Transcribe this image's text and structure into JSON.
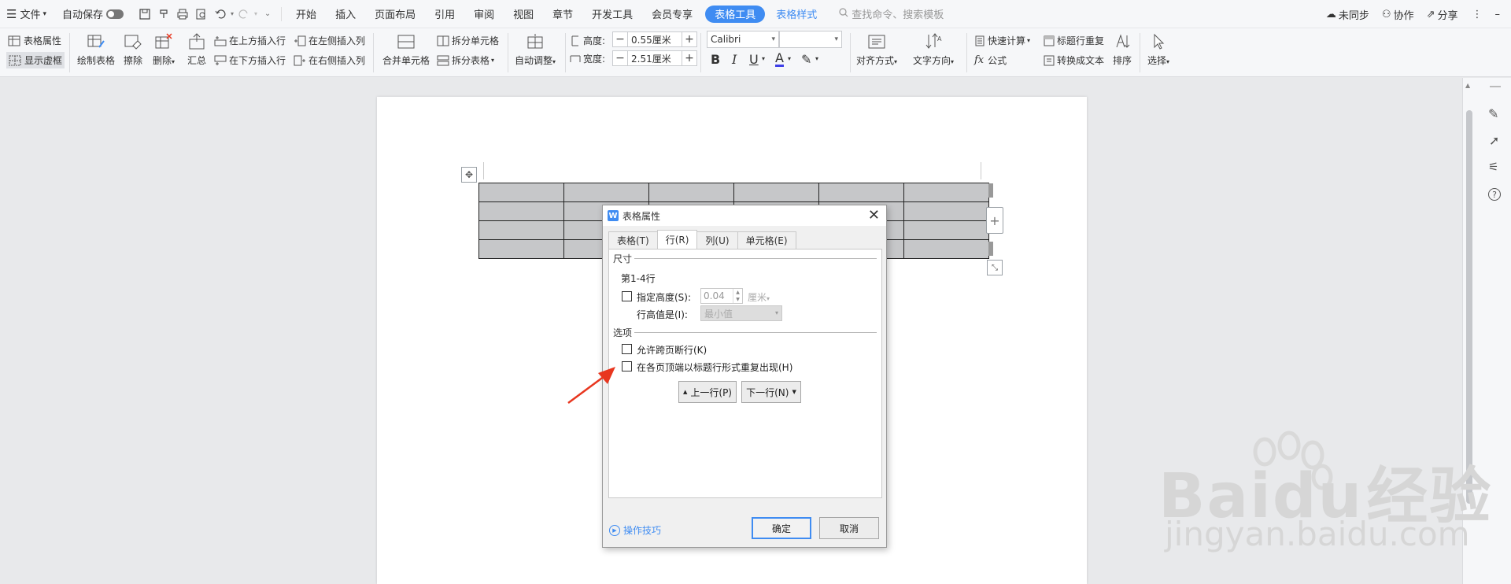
{
  "menubar": {
    "file": "文件",
    "autosave": "自动保存",
    "tabs": [
      "开始",
      "插入",
      "页面布局",
      "引用",
      "审阅",
      "视图",
      "章节",
      "开发工具",
      "会员专享"
    ],
    "active_tab": "表格工具",
    "extra_tab": "表格样式",
    "search": "查找命令、搜索模板",
    "sync": "未同步",
    "collab": "协作",
    "share": "分享"
  },
  "ribbon": {
    "table_props": "表格属性",
    "show_grid": "显示虚框",
    "draw_table": "绘制表格",
    "erase": "擦除",
    "delete": "删除",
    "summary": "汇总",
    "insert_above": "在上方插入行",
    "insert_below": "在下方插入行",
    "insert_left": "在左侧插入列",
    "insert_right": "在右侧插入列",
    "merge_cells": "合并单元格",
    "split_cells": "拆分单元格",
    "split_table": "拆分表格",
    "auto_adjust": "自动调整",
    "height_label": "高度:",
    "height_value": "0.55厘米",
    "width_label": "宽度:",
    "width_value": "2.51厘米",
    "font_name": "Calibri",
    "align": "对齐方式",
    "text_dir": "文字方向",
    "quick_calc": "快速计算",
    "formula": "公式",
    "repeat_header": "标题行重复",
    "to_text": "转换成文本",
    "sort": "排序",
    "select": "选择"
  },
  "dialog": {
    "title": "表格属性",
    "tabs": [
      "表格(T)",
      "行(R)",
      "列(U)",
      "单元格(E)"
    ],
    "active_tab_index": 1,
    "size_group": "尺寸",
    "rows_label": "第1-4行",
    "specify_height": "指定高度(S):",
    "height_value": "0.04",
    "unit": "厘米",
    "row_height_is": "行高值是(I):",
    "row_height_mode": "最小值",
    "options_group": "选项",
    "allow_break": "允许跨页断行(K)",
    "repeat_header": "在各页顶端以标题行形式重复出现(H)",
    "prev_row": "上一行(P)",
    "next_row": "下一行(N)",
    "tips": "操作技巧",
    "ok": "确定",
    "cancel": "取消"
  },
  "watermark": {
    "brand": "Bai",
    "brand2": "du",
    "cn": "经验",
    "url": "jingyan.baidu.com"
  },
  "colors": {
    "accent": "#3f8cf2",
    "arrow": "#e8361f"
  }
}
